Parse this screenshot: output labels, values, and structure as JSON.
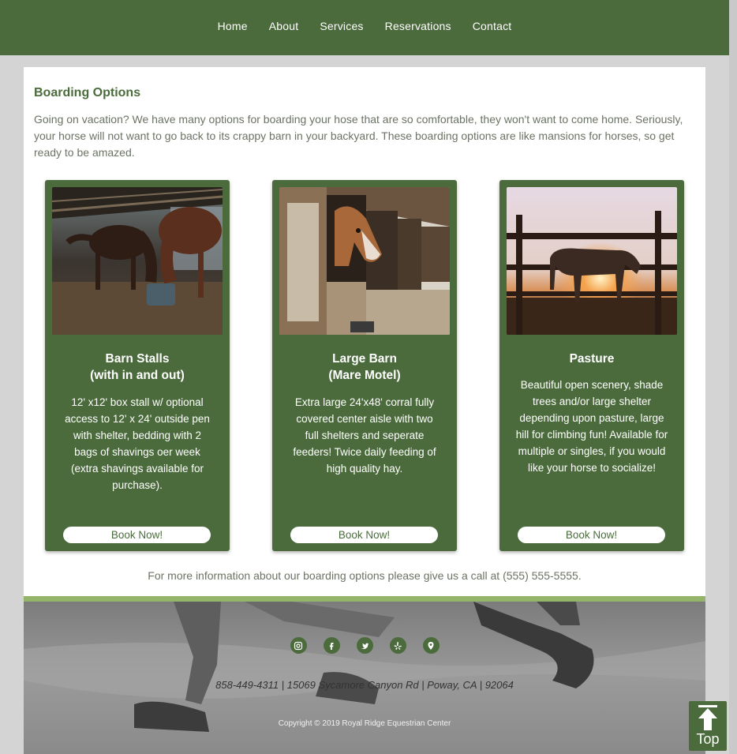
{
  "nav": {
    "items": [
      "Home",
      "About",
      "Services",
      "Reservations",
      "Contact"
    ]
  },
  "main": {
    "title": "Boarding Options",
    "intro": "Going on vacation? We have many options for boarding your hose that are so comfortable, they won't want to come home. Seriously, your horse will not want to go back to its crappy barn in your backyard. These boarding options are like mansions for horses, so get ready to be amazed.",
    "cards": [
      {
        "title_line1": "Barn Stalls",
        "title_line2": "(with in and out)",
        "description": "12' x12' box stall w/ optional access to 12' x 24' outside pen with shelter, bedding with 2 bags of shavings oer week (extra shavings available for purchase).",
        "button": "Book Now!"
      },
      {
        "title_line1": "Large Barn",
        "title_line2": "(Mare Motel)",
        "description": "Extra large 24'x48' corral fully covered center aisle with two full shelters and seperate feeders! Twice daily feeding of high quality hay.",
        "button": "Book Now!"
      },
      {
        "title_line1": "Pasture",
        "title_line2": "",
        "description": "Beautiful open scenery, shade trees and/or large shelter depending upon pasture, large hill for climbing fun! Available for multiple or singles, if you would like your horse to socialize!",
        "button": "Book Now!"
      }
    ],
    "more_info": "For more information about our boarding options please give us a call at (555) 555-5555."
  },
  "footer": {
    "social_icons": [
      "instagram-icon",
      "facebook-icon",
      "twitter-icon",
      "yelp-icon",
      "location-pin-icon"
    ],
    "address": "858-449-4311 | 15069 Sycamore Canyon Rd | Poway, CA | 92064",
    "copyright": "Copyright © 2019 Royal Ridge Equestrian Center"
  },
  "top_button": {
    "label": "Top"
  },
  "colors": {
    "brand_green": "#4b6b3c",
    "accent_light_green": "#93b469",
    "page_gray": "#d4d4d4",
    "text_gray": "#6b7364"
  }
}
